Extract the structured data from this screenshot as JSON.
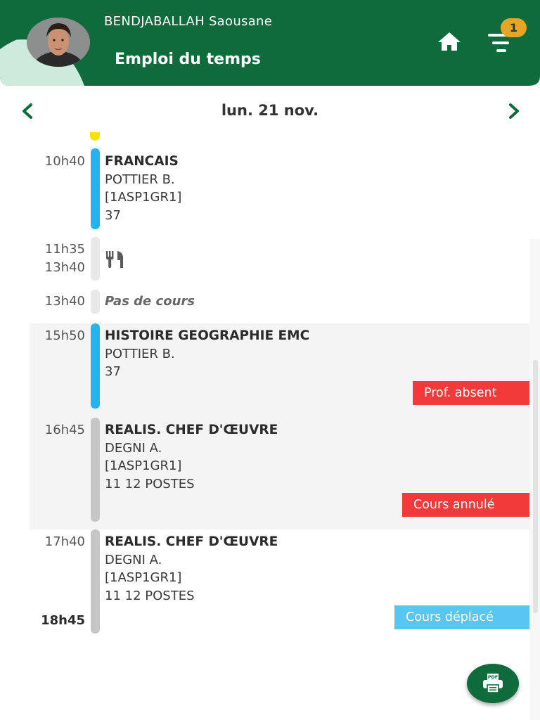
{
  "header": {
    "user_name": "BENDJABALLAH Saousane",
    "title": "Emploi du temps",
    "notification_count": "1",
    "avatar": "user-avatar"
  },
  "date_nav": {
    "label": "lun. 21 nov."
  },
  "lunch": {
    "start": "11h35",
    "end": "13h40",
    "icon": "fork-knife-icon"
  },
  "free": {
    "start": "13h40",
    "label": "Pas de cours"
  },
  "courses": [
    {
      "start": "10h40",
      "subject": "FRANCAIS",
      "teacher": "POTTIER B.",
      "group": "[1ASP1GR1]",
      "room": "37"
    },
    {
      "start": "15h50",
      "subject": "HISTOIRE GEOGRAPHIE EMC",
      "teacher": "POTTIER B.",
      "room": "37",
      "status": "Prof. absent"
    },
    {
      "start": "16h45",
      "subject": "REALIS. CHEF D'ŒUVRE",
      "teacher": "DEGNI A.",
      "group": "[1ASP1GR1]",
      "room": "11 12 POSTES",
      "status": "Cours annulé"
    },
    {
      "start": "17h40",
      "end": "18h45",
      "subject": "REALIS. CHEF D'ŒUVRE",
      "teacher": "DEGNI A.",
      "group": "[1ASP1GR1]",
      "room": "11 12 POSTES",
      "status": "Cours déplacé"
    }
  ],
  "fab": {
    "label": "PDF",
    "icon": "pdf-printer-icon"
  },
  "colors": {
    "header_green": "#0f6a3c",
    "header_light": "#cdebdc",
    "accent_blue": "#22b5ec",
    "status_red": "#f23a3a",
    "status_cyan": "#57c6f0",
    "badge": "#e5a628"
  }
}
